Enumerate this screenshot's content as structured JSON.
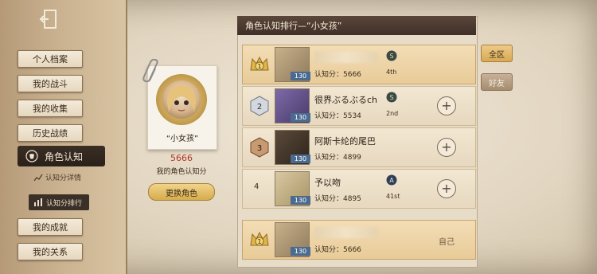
{
  "sidebar": {
    "items": [
      {
        "label": "个人档案"
      },
      {
        "label": "我的战斗"
      },
      {
        "label": "我的收集"
      },
      {
        "label": "历史战绩"
      }
    ],
    "active_item": {
      "label": "角色认知"
    },
    "sub_items": [
      {
        "label": "认知分详情"
      },
      {
        "label": "认知分排行"
      }
    ],
    "items_after": [
      {
        "label": "我的成就"
      },
      {
        "label": "我的关系"
      }
    ]
  },
  "profile": {
    "character_name": "“小女孩”",
    "score": "5666",
    "score_caption": "我的角色认知分",
    "change_button": "更换角色"
  },
  "ranking": {
    "title": "角色认知排行—“小女孩”",
    "level_tag": "130",
    "rows": [
      {
        "rank": "1",
        "name": "",
        "score_text": "认知分：5666",
        "badge_label": "4th",
        "badge_letter": "S"
      },
      {
        "rank": "2",
        "name": "很界ぶるぶるch",
        "score_text": "认知分：5534",
        "badge_label": "2nd",
        "badge_letter": "S"
      },
      {
        "rank": "3",
        "name": "阿斯卡纶的尾巴",
        "score_text": "认知分：4899",
        "badge_label": "",
        "badge_letter": ""
      },
      {
        "rank": "4",
        "name": "予以吻",
        "score_text": "认知分：4895",
        "badge_label": "41st",
        "badge_letter": "A"
      }
    ],
    "self_row": {
      "rank": "1",
      "name": "",
      "score_text": "认知分：5666",
      "self_label": "自己"
    }
  },
  "tabs": [
    {
      "label": "全区"
    },
    {
      "label": "好友"
    }
  ],
  "colors": {
    "row_highlight": "#f3ddb6",
    "title_bar": "#4a382d",
    "score_red": "#b2332a"
  }
}
